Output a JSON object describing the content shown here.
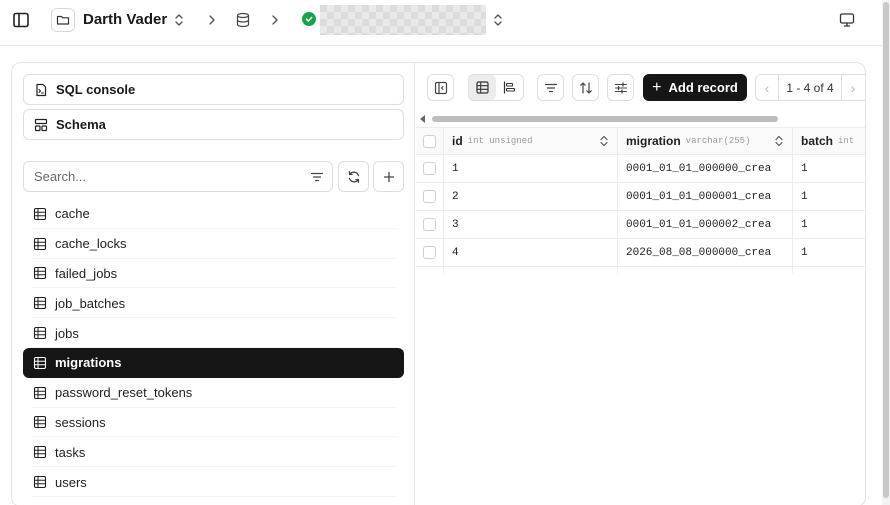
{
  "header": {
    "project_name": "Darth Vader",
    "connection_name": "",
    "connection_status_color": "#16a34a",
    "icons": [
      "sidebar-toggle-icon",
      "folder-icon",
      "chevron-up-down-icon",
      "chevron-right-icon",
      "database-icon",
      "monitor-icon"
    ]
  },
  "sidebar": {
    "sql_console_label": "SQL console",
    "schema_label": "Schema",
    "search_placeholder": "Search...",
    "tables": [
      {
        "label": "cache",
        "active": false
      },
      {
        "label": "cache_locks",
        "active": false
      },
      {
        "label": "failed_jobs",
        "active": false
      },
      {
        "label": "job_batches",
        "active": false
      },
      {
        "label": "jobs",
        "active": false
      },
      {
        "label": "migrations",
        "active": true
      },
      {
        "label": "password_reset_tokens",
        "active": false
      },
      {
        "label": "sessions",
        "active": false
      },
      {
        "label": "tasks",
        "active": false
      },
      {
        "label": "users",
        "active": false
      }
    ]
  },
  "toolbar": {
    "add_record_label": "Add record",
    "pagination_text": "1 - 4 of 4"
  },
  "grid": {
    "columns": [
      {
        "name": "id",
        "type": "int unsigned"
      },
      {
        "name": "migration",
        "type": "varchar(255)"
      },
      {
        "name": "batch",
        "type": "int"
      }
    ],
    "rows": [
      [
        "1",
        "0001_01_01_000000_crea",
        "1"
      ],
      [
        "2",
        "0001_01_01_000001_crea",
        "1"
      ],
      [
        "3",
        "0001_01_01_000002_crea",
        "1"
      ],
      [
        "4",
        "2026_08_08_000000_crea",
        "1"
      ]
    ]
  },
  "colors": {
    "accent_dark": "#161616",
    "status_green": "#16a34a"
  }
}
